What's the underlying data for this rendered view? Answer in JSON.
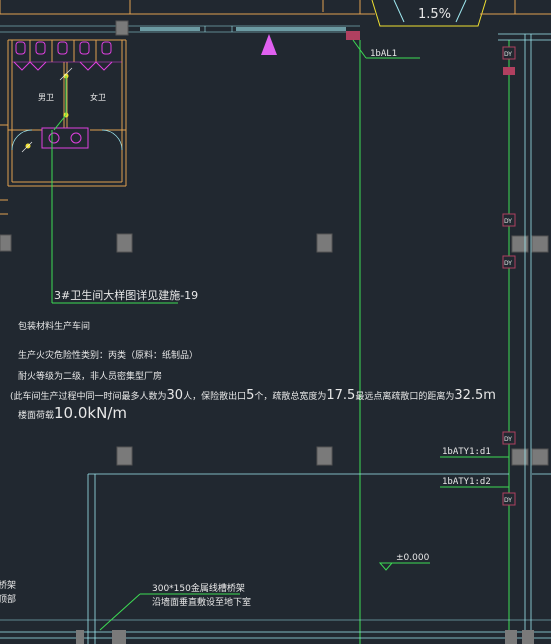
{
  "drawing": {
    "slope_label": "1.5%",
    "panel_top": "1bAL1",
    "panel_d1": "1bATY1:d1",
    "panel_d2": "1bATY1:d2",
    "riser_tag": "DY",
    "room_male": "男卫",
    "room_female": "女卫",
    "detail_note": "3#卫生间大样图详见建施-19",
    "elevation": "±0.000",
    "tray_note_1": "300*150金属线槽桥架",
    "tray_note_2": "沿墙面垂直敷设至地下室",
    "left_edge_1": "桥架",
    "left_edge_2": "顶部"
  },
  "notes": {
    "line1": "包装材料生产车间",
    "line2": "生产火灾危险性类别：丙类（原料：纸制品）",
    "line3": "耐火等级为二级，非人员密集型厂房",
    "line4a": "(此车间生产过程中同一时间最多人数为",
    "line4b": "30",
    "line4c": "人，保险散出口",
    "line4d": "5",
    "line4e": "个，疏散总宽度为",
    "line4f": "17.5",
    "line4g": "最远点离疏散口的距离为",
    "line4h": "32.5m",
    "line5a": "楼面荷载",
    "line5b": "10.0kN/m"
  },
  "colors": {
    "background": "#212830",
    "wall": "#e0a050",
    "wiring": "#3ddc54",
    "fixture": "#e040e0",
    "column": "#7a7a7a",
    "cyan": "#9ee8f0",
    "text": "#e8e8e8",
    "yellow": "#f0e030"
  }
}
